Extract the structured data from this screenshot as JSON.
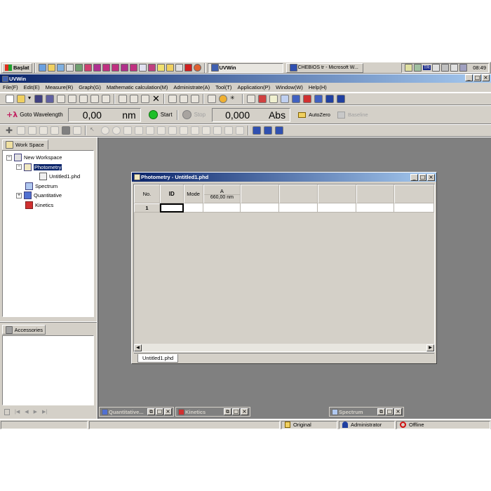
{
  "taskbar": {
    "start_label": "Başlat",
    "tasks": [
      {
        "label": "UVWin",
        "active": true
      },
      {
        "label": "CHEBIOS tr - Microsoft W...",
        "active": false
      }
    ],
    "tray_lang": "TR",
    "clock": "08:49"
  },
  "app": {
    "title": "UVWin",
    "menus": [
      "File(F)",
      "Edit(E)",
      "Measure(R)",
      "Graph(G)",
      "Mathematic calculation(M)",
      "Administrate(A)",
      "Tool(T)",
      "Application(P)",
      "Window(W)",
      "Help(H)"
    ]
  },
  "measure_bar": {
    "goto_label": "Goto Wavelength",
    "wavelength_value": "0,00",
    "wavelength_unit": "nm",
    "start_label": "Start",
    "stop_label": "Stop",
    "absorbance_value": "0,000",
    "absorbance_unit": "Abs",
    "autozero_label": "AutoZero",
    "baseline_label": "Baseline"
  },
  "workspace": {
    "tab_label": "Work Space",
    "tree": [
      {
        "label": "New Workspace",
        "level": 0,
        "expander": "minus"
      },
      {
        "label": "Photometry",
        "level": 1,
        "expander": "minus",
        "selected": true
      },
      {
        "label": "Untitled1.phd",
        "level": 2,
        "expander": ""
      },
      {
        "label": "Spectrum",
        "level": 1,
        "expander": ""
      },
      {
        "label": "Quantitative",
        "level": 1,
        "expander": "plus"
      },
      {
        "label": "Kinetics",
        "level": 1,
        "expander": ""
      }
    ]
  },
  "accessories": {
    "tab_label": "Accessories"
  },
  "photometry_window": {
    "title": "Photometry - Untitled1.phd",
    "columns": {
      "no": "No.",
      "id": "ID",
      "mode": "Mode",
      "a_title": "A",
      "a_sub": "660,00 nm"
    },
    "rows": [
      {
        "no": "1",
        "id": "",
        "mode": "",
        "a": ""
      }
    ],
    "sheet_tab": "Untitled1.phd"
  },
  "minimized_windows": [
    {
      "label": "Quantitative..."
    },
    {
      "label": "Kinetics"
    },
    {
      "label": "Spectrum"
    }
  ],
  "statusbar": {
    "mode": "Original",
    "user": "Administrator",
    "connection": "Offline"
  },
  "colors": {
    "face": "#d4d0c8",
    "title_active": "#0a246a",
    "title_inactive": "#808080",
    "mdi_background": "#808080",
    "selection": "#0a246a",
    "start_green": "#1fbf2a",
    "offline_red": "#d01010"
  }
}
